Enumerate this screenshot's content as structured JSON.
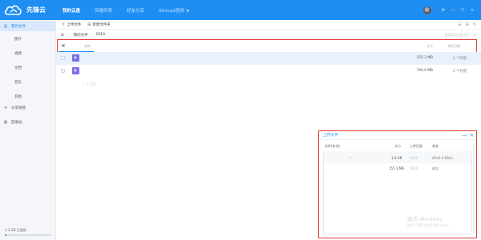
{
  "app": {
    "name": "先锋云",
    "brand_color": "#1e8ef3"
  },
  "topnav": {
    "items": [
      "我的云盘",
      "传输列表",
      "好友分享",
      "Xfcloud官网"
    ],
    "active": "我的云盘"
  },
  "sidebar": {
    "items": [
      {
        "label": "我的文件",
        "icon": "file-icon",
        "active": true
      },
      {
        "label": "图片",
        "icon": "",
        "sub": true
      },
      {
        "label": "视频",
        "icon": "",
        "sub": true
      },
      {
        "label": "文档",
        "icon": "",
        "sub": true
      },
      {
        "label": "音乐",
        "icon": "",
        "sub": true
      },
      {
        "label": "其他",
        "icon": "",
        "sub": true
      },
      {
        "label": "分享链接",
        "icon": "share-icon"
      },
      {
        "label": "回收站",
        "icon": "trash-icon"
      }
    ],
    "storage_text": "1.3 GB 已使用",
    "storage_fraction": 0.03
  },
  "toolbar": {
    "upload_label": "上传文件",
    "new_folder_label": "新建文件夹"
  },
  "path": {
    "crumbs": [
      "我的文件",
      "1010"
    ],
    "search_placeholder": "搜索我的云盘文件"
  },
  "sortbar": {
    "name_col": "名称",
    "size_col": "大小",
    "date_col": "修改日期"
  },
  "files": [
    {
      "name": "",
      "size": "155.3 MB",
      "date": "2 个月前"
    },
    {
      "name": "",
      "size": "700.9 MB",
      "date": "2 个月前"
    }
  ],
  "summary": "2 个项目",
  "upload_panel": {
    "title": "上传文件",
    "columns": [
      "文件(夹)名",
      "大小",
      "上传目录",
      "状态"
    ],
    "rows": [
      {
        "name": "v4",
        "size": "1.6 GB",
        "dir": "1010",
        "status": "0%(0.0 KB/s)"
      },
      {
        "name": "·",
        "size": "155.3 MB",
        "dir": "1010",
        "status": "成功"
      }
    ],
    "watermark_line1": "激活 Windows",
    "watermark_line2": "转到\"设置\"以激活 Windows。"
  }
}
